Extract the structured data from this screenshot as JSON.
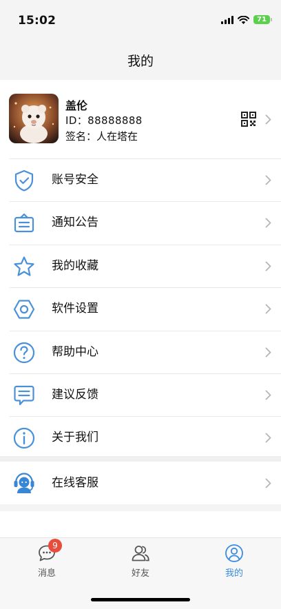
{
  "status_bar": {
    "time": "15:02",
    "battery": "71"
  },
  "header": {
    "title": "我的"
  },
  "profile": {
    "name": "盖伦",
    "id_text": "ID：88888888",
    "signature": "签名：人在塔在"
  },
  "menu": {
    "items": [
      {
        "label": "账号安全",
        "icon": "shield-check-icon"
      },
      {
        "label": "通知公告",
        "icon": "notice-icon"
      },
      {
        "label": "我的收藏",
        "icon": "star-icon"
      },
      {
        "label": "软件设置",
        "icon": "settings-hexagon-icon"
      },
      {
        "label": "帮助中心",
        "icon": "question-circle-icon"
      },
      {
        "label": "建议反馈",
        "icon": "feedback-icon"
      },
      {
        "label": "关于我们",
        "icon": "info-circle-icon"
      }
    ],
    "service": {
      "label": "在线客服",
      "icon": "customer-service-icon"
    }
  },
  "tabbar": {
    "tabs": [
      {
        "label": "消息",
        "icon": "message-icon",
        "badge": "9"
      },
      {
        "label": "好友",
        "icon": "friends-icon"
      },
      {
        "label": "我的",
        "icon": "profile-icon",
        "active": true
      }
    ]
  },
  "colors": {
    "accent": "#3a8be0",
    "icon_blue": "#4a90d9",
    "badge": "#e74c3c"
  }
}
